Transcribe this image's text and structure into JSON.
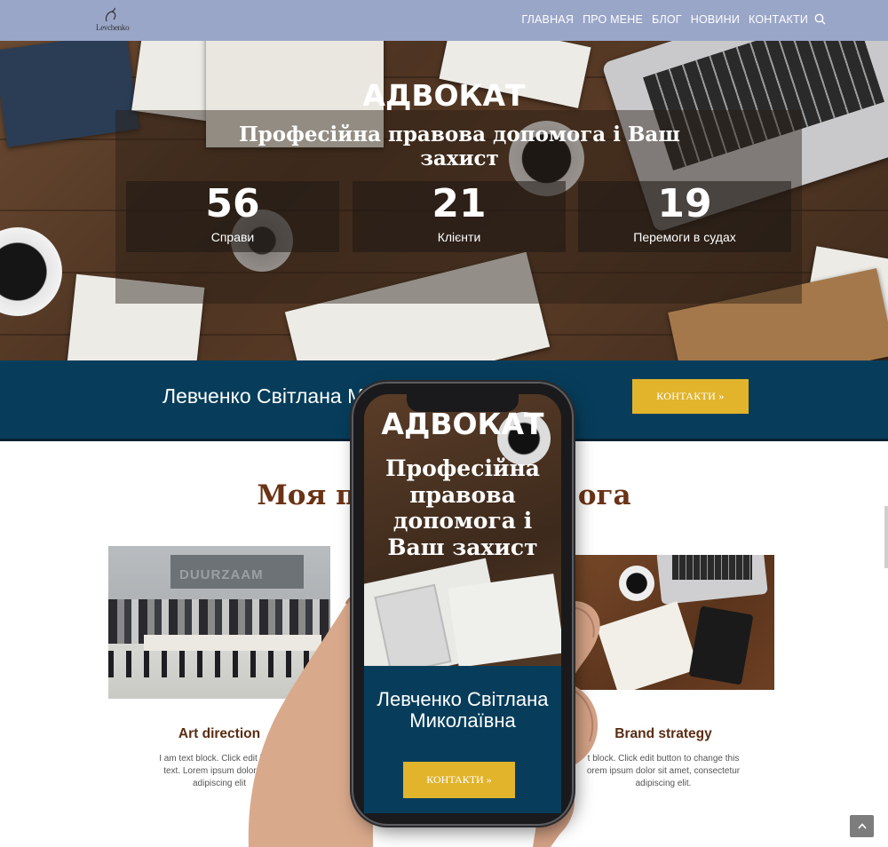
{
  "header": {
    "logo_text": "Levchenko",
    "nav": [
      "ГЛАВНАЯ",
      "ПРО МЕНЕ",
      "БЛОГ",
      "НОВИНИ",
      "КОНТАКТИ"
    ],
    "search_icon": "search-icon"
  },
  "hero": {
    "title": "АДВОКАТ",
    "subtitle": "Професійна правова допомога і Ваш захист",
    "stats": [
      {
        "value": "56",
        "label": "Справи"
      },
      {
        "value": "21",
        "label": "Клієнти"
      },
      {
        "value": "19",
        "label": "Перемоги в судах"
      }
    ]
  },
  "band": {
    "name": "Левченко Світлана Миколаївна",
    "visible_name": "Левченко Світлана М",
    "button": "КОНТАКТИ »"
  },
  "services": {
    "title_left": "Моя п",
    "title_right": "ога",
    "items": [
      {
        "heading": "Art direction",
        "text": "I am text block. Click edit button to change this text. Lorem ipsum dolor sit amet, consectetur adipiscing elit."
      },
      {
        "heading": "Brand strategy",
        "text": "I am text block. Click edit button to change this text. Lorem ipsum dolor sit amet, consectetur adipiscing elit."
      }
    ],
    "left_text_lines": [
      "I am text block. Click edit butto",
      "text. Lorem ipsum dolor sit a",
      "adipiscing elit"
    ],
    "right_text_lines": [
      "t block. Click edit button to change this",
      "orem ipsum dolor sit amet, consectetur",
      "adipiscing elit."
    ],
    "image_sign": "DUURZAAM"
  },
  "phone": {
    "title": "АДВОКАТ",
    "subtitle": "Професійна правова допомога і Ваш захист",
    "name": "Левченко Світлана Миколаївна",
    "button": "КОНТАКТИ »"
  },
  "colors": {
    "header_bg": "#9aa6c8",
    "band_bg": "#073d5b",
    "button_bg": "#e1b42c",
    "heading_brown": "#6a3316"
  },
  "icons": [
    "search-icon",
    "chevron-up-icon"
  ]
}
